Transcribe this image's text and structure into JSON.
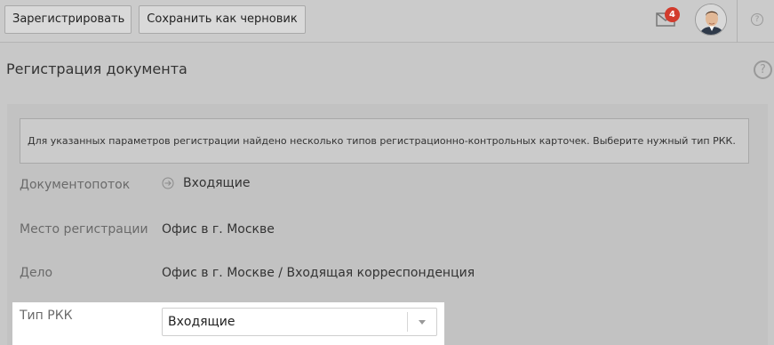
{
  "toolbar": {
    "register_label": "Зарегистрировать",
    "draft_label": "Сохранить как черновик",
    "mail_badge": "4",
    "help_label": "?"
  },
  "page": {
    "title": "Регистрация документа",
    "help_label": "?"
  },
  "notice": "Для указанных параметров регистрации найдено несколько типов регистрационно-контрольных карточек. Выберите нужный тип РКК.",
  "fields": {
    "flow": {
      "label": "Документопоток",
      "value": "Входящие"
    },
    "place": {
      "label": "Место регистрации",
      "value": "Офис в г. Москве"
    },
    "case": {
      "label": "Дело",
      "value": "Офис в г. Москве / Входящая корреспонденция"
    },
    "rkk": {
      "label": "Тип РКК",
      "value": "Входящие"
    }
  },
  "icons": {
    "mail": "envelope-icon",
    "flow": "arrow-circle-icon",
    "caret": "chevron-down-icon"
  },
  "colors": {
    "badge": "#d23b2d",
    "highlight": "#ffffff"
  }
}
